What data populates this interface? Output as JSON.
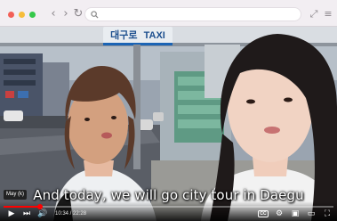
{
  "browser": {
    "url": "",
    "nav": {
      "back": "‹",
      "forward": "›",
      "reload": "↻"
    },
    "icons": [
      "search-icon",
      "share-icon",
      "menu-icon"
    ]
  },
  "video": {
    "sign_korean": "대구로",
    "sign_english": "TAXI",
    "subtitle": "And today, we will go city tour in Daegu",
    "chapter_label": "May (k)",
    "time_display": "10:34 / 22:28",
    "progress_fraction": 0.11,
    "controls": {
      "play": "play-icon",
      "next": "next-icon",
      "volume": "volume-icon",
      "captions": "cc-icon",
      "settings": "gear-icon",
      "miniplayer": "miniplayer-icon",
      "theater": "theater-icon",
      "fullscreen": "fullscreen-icon"
    },
    "colors": {
      "progress": "#ff0000",
      "chrome": "#f2eef2"
    }
  }
}
